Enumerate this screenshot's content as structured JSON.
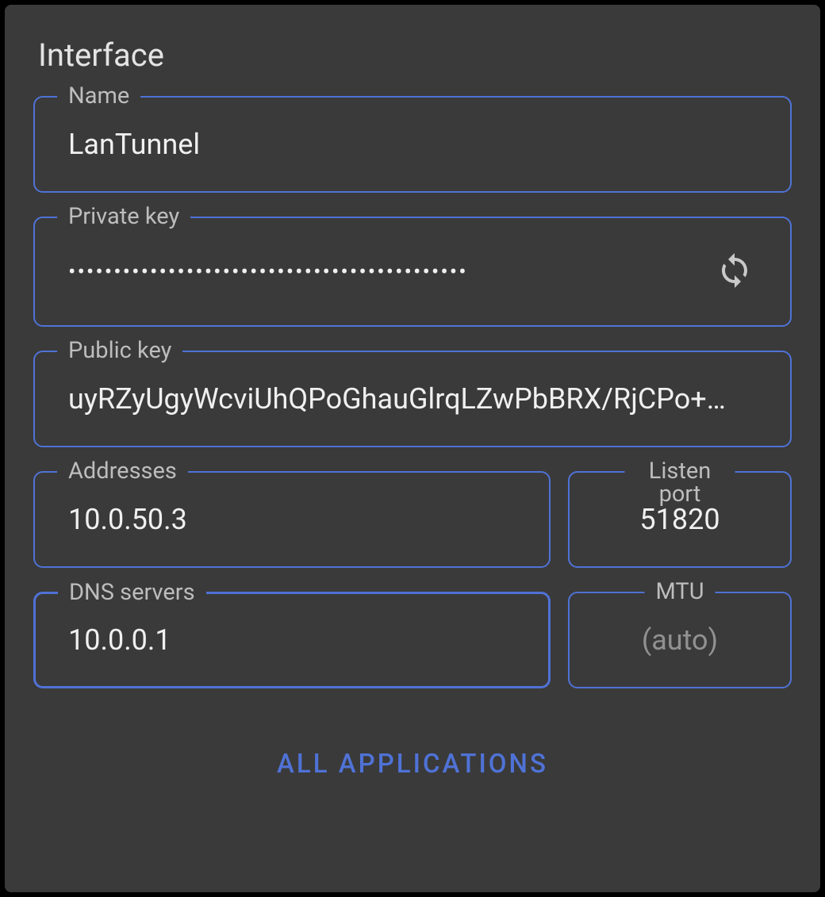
{
  "section_title": "Interface",
  "fields": {
    "name": {
      "label": "Name",
      "value": "LanTunnel"
    },
    "private_key": {
      "label": "Private key",
      "value": "••••••••••••••••••••••••••••••••••••••••••••"
    },
    "public_key": {
      "label": "Public key",
      "value": "uyRZyUgyWcviUhQPoGhauGlrqLZwPbBRX/RjCPo+…"
    },
    "addresses": {
      "label": "Addresses",
      "value": "10.0.50.3"
    },
    "listen_port": {
      "label": "Listen port",
      "value": "51820"
    },
    "dns_servers": {
      "label": "DNS servers",
      "value": "10.0.0.1"
    },
    "mtu": {
      "label": "MTU",
      "value": "",
      "placeholder": "(auto)"
    }
  },
  "apps_button_label": "ALL APPLICATIONS"
}
